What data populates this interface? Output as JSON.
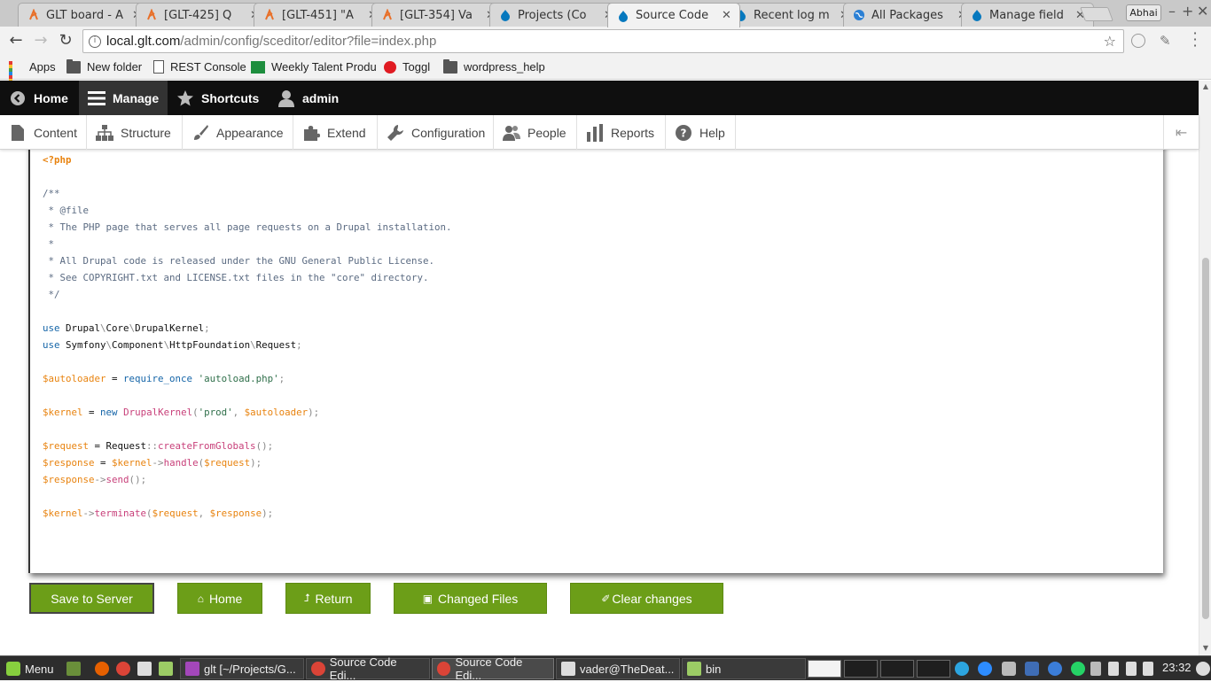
{
  "browser": {
    "tabs": [
      {
        "label": "GLT board - A",
        "icon": "jira-icon",
        "active": false
      },
      {
        "label": "[GLT-425] Q",
        "icon": "jira-icon",
        "active": false
      },
      {
        "label": "[GLT-451] \"A",
        "icon": "jira-icon",
        "active": false
      },
      {
        "label": "[GLT-354] Va",
        "icon": "jira-icon",
        "active": false
      },
      {
        "label": "Projects (Co",
        "icon": "drupal-icon",
        "active": false
      },
      {
        "label": "Source Code",
        "icon": "drupal-icon",
        "active": true
      },
      {
        "label": "Recent log m",
        "icon": "drupal-icon",
        "active": false
      },
      {
        "label": "All Packages",
        "icon": "globe-icon",
        "active": false
      },
      {
        "label": "Manage field",
        "icon": "drupal-icon",
        "active": false
      }
    ],
    "profile_name": "Abhai",
    "url_host": "local.glt.com",
    "url_path": "/admin/config/sceditor/editor?file=index.php",
    "bookmarks": [
      {
        "label": "Apps",
        "icon": "apps-icon"
      },
      {
        "label": "New folder",
        "icon": "folder-icon"
      },
      {
        "label": "REST Console",
        "icon": "page-icon"
      },
      {
        "label": "Weekly Talent Produ",
        "icon": "sheets-icon"
      },
      {
        "label": "Toggl",
        "icon": "toggl-icon"
      },
      {
        "label": "wordpress_help",
        "icon": "folder-icon"
      }
    ]
  },
  "drupal": {
    "toolbar": [
      {
        "label": "Home",
        "icon": "back-circle-icon"
      },
      {
        "label": "Manage",
        "icon": "hamburger-icon"
      },
      {
        "label": "Shortcuts",
        "icon": "star-icon"
      },
      {
        "label": "admin",
        "icon": "user-icon"
      }
    ],
    "tray": [
      {
        "label": "Content",
        "icon": "file-icon"
      },
      {
        "label": "Structure",
        "icon": "sitemap-icon"
      },
      {
        "label": "Appearance",
        "icon": "brush-icon"
      },
      {
        "label": "Extend",
        "icon": "puzzle-icon"
      },
      {
        "label": "Configuration",
        "icon": "wrench-icon"
      },
      {
        "label": "People",
        "icon": "people-icon"
      },
      {
        "label": "Reports",
        "icon": "bar-chart-icon"
      },
      {
        "label": "Help",
        "icon": "help-icon"
      }
    ]
  },
  "editor": {
    "filename": "index.php",
    "lines": [
      "<?php",
      "",
      "/**",
      " * @file",
      " * The PHP page that serves all page requests on a Drupal installation.",
      " *",
      " * All Drupal code is released under the GNU General Public License.",
      " * See COPYRIGHT.txt and LICENSE.txt files in the \"core\" directory.",
      " */",
      "",
      "use Drupal\\Core\\DrupalKernel;",
      "use Symfony\\Component\\HttpFoundation\\Request;",
      "",
      "$autoloader = require_once 'autoload.php';",
      "",
      "$kernel = new DrupalKernel('prod', $autoloader);",
      "",
      "$request = Request::createFromGlobals();",
      "$response = $kernel->handle($request);",
      "$response->send();",
      "",
      "$kernel->terminate($request, $response);"
    ]
  },
  "actions": {
    "save": "Save to Server",
    "home": "Home",
    "return": "Return",
    "changed": "Changed Files",
    "clear": "Clear changes"
  },
  "taskbar": {
    "menu": "Menu",
    "windows": [
      {
        "label": "glt [~/Projects/G...",
        "icon": "phpstorm-icon"
      },
      {
        "label": "Source Code Edi...",
        "icon": "chrome-icon"
      },
      {
        "label": "Source Code Edi...",
        "icon": "chrome-icon"
      },
      {
        "label": "vader@TheDeat...",
        "icon": "terminal-icon"
      },
      {
        "label": "bin",
        "icon": "folder-icon"
      }
    ],
    "clock": "23:32"
  },
  "colors": {
    "button_green": "#6c9e18",
    "drupal_black": "#0f0f0f",
    "jira_orange": "#e8702a",
    "drupal_blue": "#0678be"
  }
}
